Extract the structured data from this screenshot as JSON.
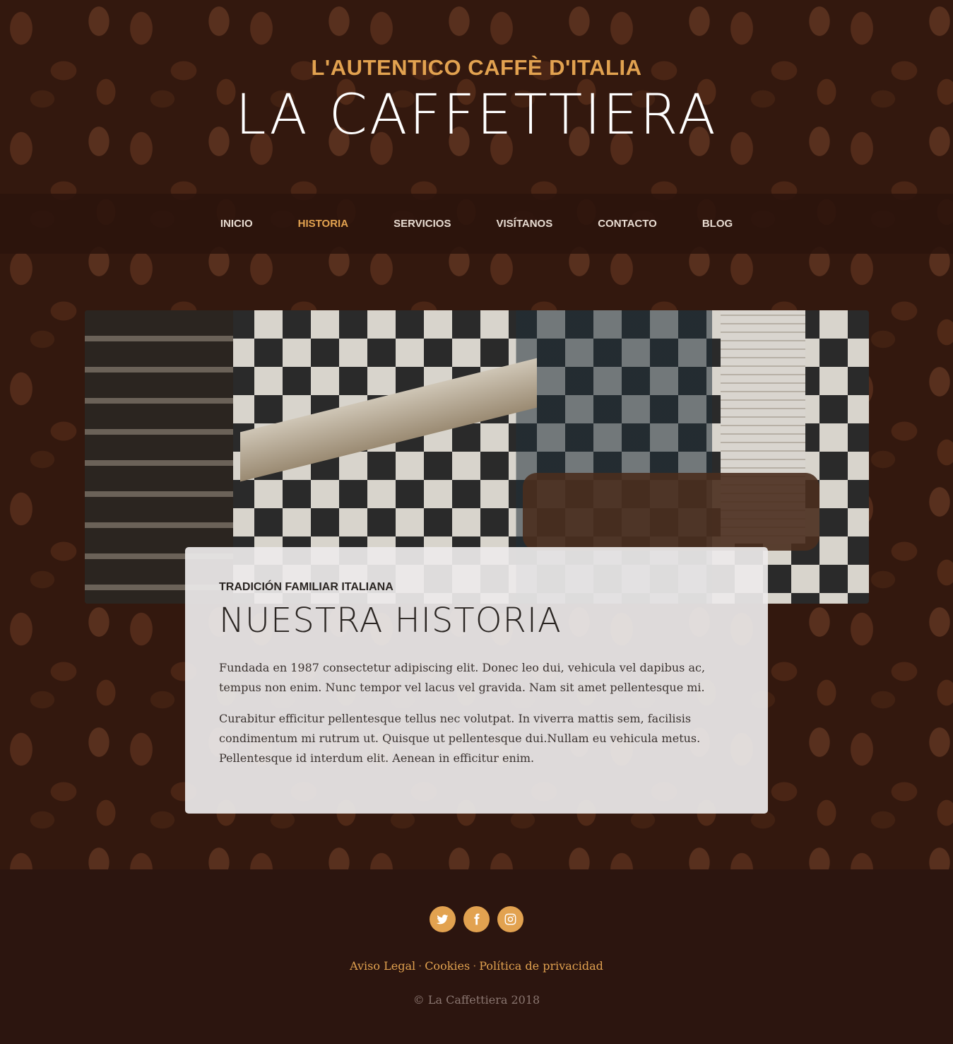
{
  "header": {
    "tagline": "L'AUTENTICO CAFFÈ D'ITALIA",
    "brand": "LA CAFFETTIERA"
  },
  "nav": {
    "items": [
      {
        "label": "INICIO",
        "active": false
      },
      {
        "label": "HISTORIA",
        "active": true
      },
      {
        "label": "SERVICIOS",
        "active": false
      },
      {
        "label": "VISÍTANOS",
        "active": false
      },
      {
        "label": "CONTACTO",
        "active": false
      },
      {
        "label": "BLOG",
        "active": false
      }
    ]
  },
  "about": {
    "eyebrow": "TRADICIÓN FAMILIAR ITALIANA",
    "title": "NUESTRA HISTORIA",
    "paragraphs": [
      "Fundada en 1987 consectetur adipiscing elit. Donec leo dui, vehicula vel dapibus ac, tempus non enim. Nunc tempor vel lacus vel gravida. Nam sit amet pellentesque mi.",
      "Curabitur efficitur pellentesque tellus nec volutpat. In viverra mattis sem, facilisis condimentum mi rutrum ut. Quisque ut pellentesque dui.Nullam eu vehicula metus. Pellentesque id interdum elit. Aenean in efficitur enim."
    ]
  },
  "footer": {
    "social": [
      {
        "icon": "twitter-icon"
      },
      {
        "icon": "facebook-icon"
      },
      {
        "icon": "instagram-icon"
      }
    ],
    "links": {
      "legal": "Aviso Legal",
      "cookies": "Cookies",
      "privacy": "Política de privacidad",
      "separator": "·"
    },
    "copyright": "© La Caffettiera 2018"
  },
  "colors": {
    "accent": "#e2a250",
    "footer_bg": "#2c150f",
    "nav_bg": "#2b130c"
  }
}
